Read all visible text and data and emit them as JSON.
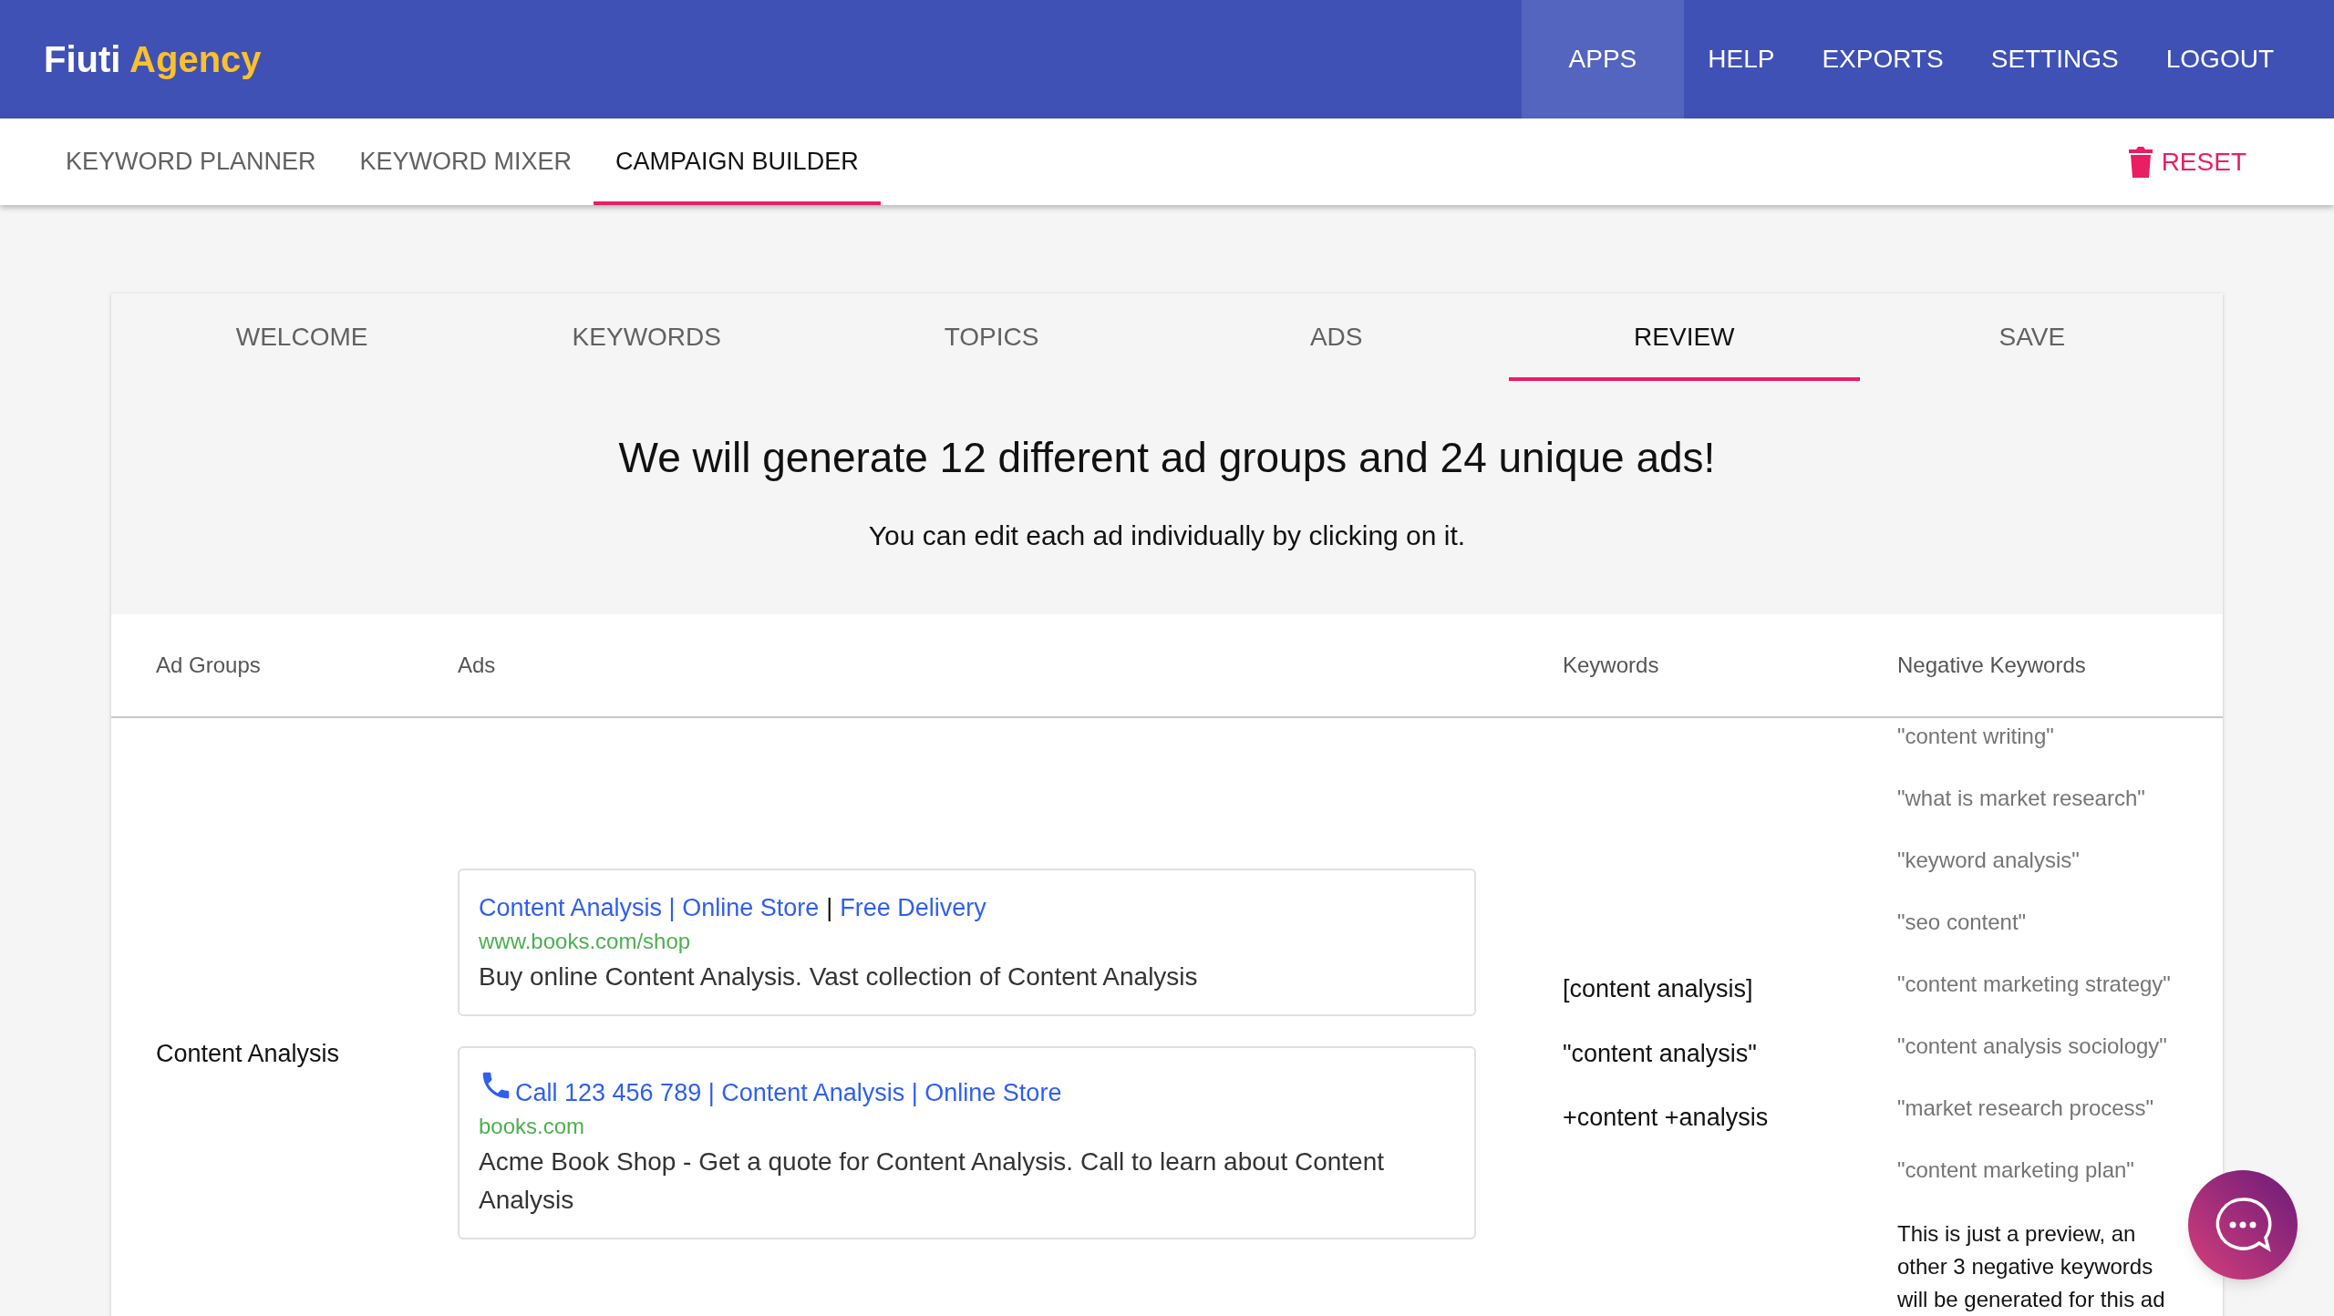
{
  "brand": {
    "name": "Fiuti",
    "accent": "Agency"
  },
  "top_nav": [
    {
      "label": "APPS",
      "selected": true
    },
    {
      "label": "HELP",
      "selected": false
    },
    {
      "label": "EXPORTS",
      "selected": false
    },
    {
      "label": "SETTINGS",
      "selected": false
    },
    {
      "label": "LOGOUT",
      "selected": false
    }
  ],
  "sub_tabs": [
    {
      "label": "KEYWORD PLANNER",
      "selected": false
    },
    {
      "label": "KEYWORD MIXER",
      "selected": false
    },
    {
      "label": "CAMPAIGN BUILDER",
      "selected": true
    }
  ],
  "reset_button": "RESET",
  "steps": [
    {
      "label": "WELCOME",
      "selected": false
    },
    {
      "label": "KEYWORDS",
      "selected": false
    },
    {
      "label": "TOPICS",
      "selected": false
    },
    {
      "label": "ADS",
      "selected": false
    },
    {
      "label": "REVIEW",
      "selected": true
    },
    {
      "label": "SAVE",
      "selected": false
    }
  ],
  "heading": "We will generate 12 different ad groups and 24 unique ads!",
  "subheading": "You can edit each ad individually by clicking on it.",
  "table": {
    "columns": [
      "Ad Groups",
      "Ads",
      "Keywords",
      "Negative Keywords"
    ],
    "rows": [
      {
        "ad_group": "Content Analysis",
        "ads": [
          {
            "kind": "standard",
            "headline": [
              {
                "kind": "link",
                "text": "Content Analysis | Online Store"
              },
              {
                "kind": "separator",
                "text": "|"
              },
              {
                "kind": "link",
                "text": "Free Delivery"
              }
            ],
            "url": "www.books.com/shop",
            "description": "Buy online Content Analysis. Vast collection of Content Analysis"
          },
          {
            "kind": "call",
            "headline": [
              {
                "kind": "link",
                "text": "Call 123 456 789 | Content Analysis | Online Store"
              }
            ],
            "url": "books.com",
            "description": "Acme Book Shop - Get a quote for Content Analysis. Call to learn about Content Analysis"
          }
        ],
        "keywords": [
          "[content analysis]",
          "\"content analysis\"",
          "+content +analysis"
        ],
        "negative_keywords": [
          "\"content writing\"",
          "\"what is market research\"",
          "\"keyword analysis\"",
          "\"seo content\"",
          "\"content marketing strategy\"",
          "\"content analysis sociology\"",
          "\"market research process\"",
          "\"content marketing plan\""
        ],
        "note": "This is just a preview, an other 3 negative keywords will be generated for this ad"
      }
    ]
  }
}
